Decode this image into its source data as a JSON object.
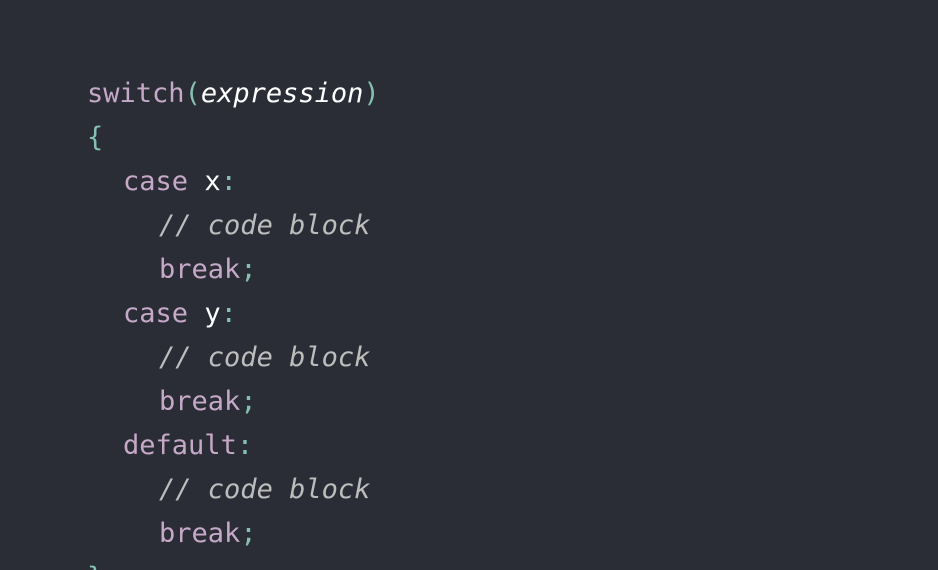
{
  "code": {
    "keyword_switch": "switch",
    "paren_open": "(",
    "expression": "expression",
    "paren_close": ")",
    "brace_open": "{",
    "cases": [
      {
        "keyword": "case",
        "value": "x",
        "colon": ":"
      },
      {
        "keyword": "case",
        "value": "y",
        "colon": ":"
      }
    ],
    "default_keyword": "default",
    "default_colon": ":",
    "comment": "// code block",
    "break_keyword": "break",
    "semicolon": ";",
    "brace_close": "}"
  },
  "colors": {
    "background": "#2a2d35",
    "keyword": "#c6a8c8",
    "punctuation": "#86c0b3",
    "identifier": "#ffffff",
    "comment": "#bdbdbd"
  }
}
